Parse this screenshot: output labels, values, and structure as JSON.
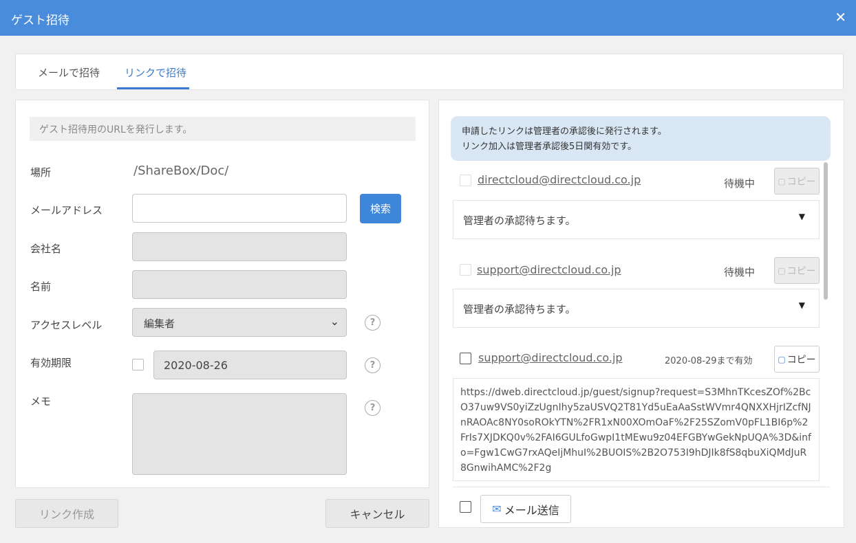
{
  "window": {
    "title": "ゲスト招待",
    "close_icon": "close-icon"
  },
  "tabs": [
    {
      "label": "メールで招待",
      "active": false
    },
    {
      "label": "リンクで招待",
      "active": true
    }
  ],
  "form": {
    "note": "ゲスト招待用のURLを発行します。",
    "location_label": "場所",
    "location_value": "/ShareBox/Doc/",
    "email_label": "メールアドレス",
    "email_value": "",
    "search_button": "検索",
    "company_label": "会社名",
    "company_value": "",
    "name_label": "名前",
    "name_value": "",
    "access_label": "アクセスレベル",
    "access_value": "編集者",
    "expiry_label": "有効期限",
    "expiry_value": "2020-08-26",
    "memo_label": "メモ",
    "memo_value": "",
    "help_glyph": "?",
    "select_arrow": "⌄"
  },
  "actions": {
    "create_link": "リンク作成",
    "cancel": "キャンセル"
  },
  "info": {
    "line1": "申請したリンクは管理者の承認後に発行されます。",
    "line2": "リンク加入は管理者承認後5日関有効です。"
  },
  "links": [
    {
      "email": "directcloud@directcloud.co.jp",
      "status": "待機中",
      "copy": "コピー",
      "message": "管理者の承認待ちます。"
    },
    {
      "email": "support@directcloud.co.jp",
      "status": "待機中",
      "copy": "コピー",
      "message": "管理者の承認待ちます。"
    },
    {
      "email": "support@directcloud.co.jp",
      "status": "2020-08-29まで有効",
      "copy": "コピー",
      "url": "https://dweb.directcloud.jp/guest/signup?request=S3MhnTKcesZOf%2BcO37uw9VS0yiZzUgnIhy5zaUSVQ2T81Yd5uEaAaSstWVmr4QNXXHjrIZcfNJnRAOAc8NY0soROkYTN%2FR1xN00XOmOaF%2F25SZomV0pFL1BI6p%2FrIs7XJDKQ0v%2FAI6GULfoGwpI1tMEwu9z04EFGBYwGekNpUQA%3D&info=Fgw1CwG7rxAQeIjMhuI%2BUOIS%2B2O753I9hDJIk8fS8qbuXiQMdJuR8GnwihAMC%2F2g"
    }
  ],
  "caret_glyph": "▼",
  "mail_send": "メール送信",
  "colors": {
    "header": "#4a8cdc",
    "accent": "#3a7bd0",
    "info_bg": "#d9e7f5"
  }
}
